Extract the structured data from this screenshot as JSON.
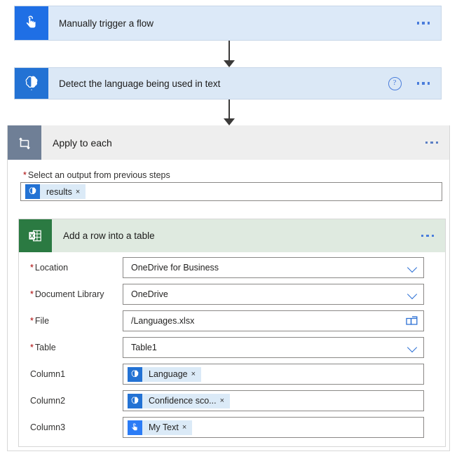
{
  "flow": {
    "trigger": {
      "title": "Manually trigger a flow",
      "icon": "hand-tap-icon",
      "accent": "#1f6fe5",
      "background": "#dce9f8",
      "menu_label": "..."
    },
    "detect_language": {
      "title": "Detect the language being used in text",
      "icon": "cognitive-brain-icon",
      "accent": "#2372d4",
      "background": "#dbe8f6",
      "help_label": "?",
      "menu_label": "..."
    },
    "apply_to_each": {
      "title": "Apply to each",
      "icon": "loop-repeat-icon",
      "accent": "#6f7f96",
      "background": "#eeeeee",
      "menu_label": "...",
      "field_label": "Select an output from previous steps",
      "field_required": true,
      "token": {
        "label": "results",
        "icon": "cognitive-brain-icon",
        "remove_label": "×"
      }
    },
    "excel_action": {
      "title": "Add a row into a table",
      "icon": "excel-icon",
      "accent": "#2b7a42",
      "background": "#dfeae0",
      "menu_label": "...",
      "fields": [
        {
          "label": "Location",
          "required": true,
          "value": "OneDrive for Business",
          "control": "dropdown",
          "icon": "chevron-down-icon"
        },
        {
          "label": "Document Library",
          "required": true,
          "value": "OneDrive",
          "control": "dropdown",
          "icon": "chevron-down-icon"
        },
        {
          "label": "File",
          "required": true,
          "value": "/Languages.xlsx",
          "control": "file-picker",
          "icon": "folder-icon"
        },
        {
          "label": "Table",
          "required": true,
          "value": "Table1",
          "control": "dropdown",
          "icon": "chevron-down-icon"
        },
        {
          "label": "Column1",
          "required": false,
          "control": "token",
          "token": {
            "label": "Language",
            "icon": "cognitive-brain-icon",
            "remove_label": "×"
          }
        },
        {
          "label": "Column2",
          "required": false,
          "control": "token",
          "token": {
            "label": "Confidence sco...",
            "icon": "cognitive-brain-icon",
            "remove_label": "×"
          }
        },
        {
          "label": "Column3",
          "required": false,
          "control": "token",
          "token": {
            "label": "My Text",
            "icon": "hand-tap-icon",
            "remove_label": "×"
          }
        }
      ]
    }
  },
  "required_marker": "*",
  "colors": {
    "accent_blue": "#2b6fd4",
    "required_red": "#a80000",
    "arrow": "#3b3a39"
  }
}
